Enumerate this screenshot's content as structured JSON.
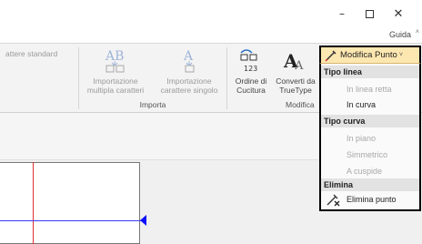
{
  "window": {
    "minimize_glyph": "–",
    "close_glyph": "✕",
    "help_label": "Guida",
    "help_caret": "˄"
  },
  "ribbon": {
    "truncated_label": "attere standard",
    "import_multi_label_1": "Importazione",
    "import_multi_label_2": "multipla caratteri",
    "import_single_label_1": "Importazione",
    "import_single_label_2": "carattere singolo",
    "import_group": "Importa",
    "sew_order_1": "Ordine di",
    "sew_order_2": "Cucitura",
    "convert_1": "Converti da",
    "convert_2": "TrueType",
    "modify_group": "Modifica"
  },
  "dropdown": {
    "label": "Modifica Punto",
    "caret": "˅"
  },
  "menu": {
    "line_type_header": "Tipo linea",
    "straight_line": "In linea retta",
    "curve": "In curva",
    "curve_type_header": "Tipo curva",
    "smooth": "In piano",
    "symmetric": "Simmetrico",
    "cusp": "A cuspide",
    "delete_header": "Elimina",
    "delete_point": "Elimina punto"
  },
  "accent_colors": {
    "dropdown_bg": "#fde7b0",
    "guide_horizontal": "#3a3aff",
    "guide_vertical": "#e03030",
    "marker": "#1010ff"
  }
}
